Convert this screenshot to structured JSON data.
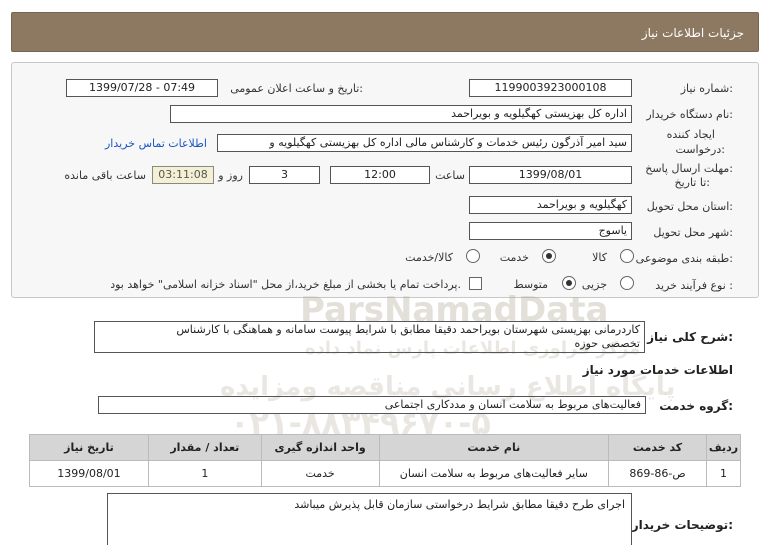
{
  "header": {
    "title": "جزئیات اطلاعات نیاز"
  },
  "fields": {
    "need_number_label": "شماره نیاز:",
    "need_number": "1199003923000108",
    "announce_label": "تاریخ و ساعت اعلان عمومی:",
    "announce_value": "1399/07/28 - 07:49",
    "buyer_label": "نام دستگاه خریدار:",
    "buyer_value": "اداره کل بهزیستی کهگیلویه و بویراحمد",
    "creator_label_1": "ایجاد کننده",
    "creator_label_2": "درخواست:",
    "creator_value": "سید امیر آذرگون رئیس خدمات و کارشناس مالی اداره کل بهزیستی کهگیلویه و",
    "contact_link": "اطلاعات تماس خریدار",
    "deadline_label_1": "مهلت ارسال پاسخ:",
    "deadline_label_2": "تا تاریخ:",
    "deadline_date": "1399/08/01",
    "time_label": "ساعت",
    "deadline_time": "12:00",
    "days_value": "3",
    "days_label": "روز و",
    "remaining_time": "03:11:08",
    "remaining_label": "ساعت باقی مانده",
    "province_label": "استان محل تحویل:",
    "province_value": "کهگیلویه و بویراحمد",
    "city_label": "شهر محل تحویل:",
    "city_value": "یاسوج",
    "category_label": "طبقه بندی موضوعی:",
    "category_options": [
      "کالا",
      "خدمت",
      "کالا/خدمت"
    ],
    "process_label": "نوع فرآیند خرید :",
    "process_options": [
      "جزیی",
      "متوسط"
    ],
    "payment_note": "پرداخت تمام یا بخشی از مبلغ خرید،از محل \"اسناد خزانه اسلامی\" خواهد بود."
  },
  "summary": {
    "label": "شرح کلی نیاز:",
    "text_line1": "کاردرمانی بهزیستی شهرستان بویراحمد دقیقا مطابق با شرایط پیوست سامانه و هماهنگی با کارشناس",
    "text_line2": "تخصصی حوزه"
  },
  "services_title": "اطلاعات خدمات مورد نیاز",
  "service_group": {
    "label": "گروه خدمت:",
    "value": "فعالیت‌های مربوط به سلامت انسان و مددکاری اجتماعی"
  },
  "table": {
    "headers": [
      "ردیف",
      "کد خدمت",
      "نام خدمت",
      "واحد اندازه گیری",
      "تعداد / مقدار",
      "تاریخ نیاز"
    ],
    "rows": [
      [
        "1",
        "ص-86-869",
        "سایر فعالیت‌های مربوط به سلامت انسان",
        "خدمت",
        "1",
        "1399/08/01"
      ]
    ]
  },
  "buyer_notes": {
    "label": "توضیحات خریدار:",
    "text": "اجرای طرح دقیقا مطابق شرایط درخواستی سازمان قابل پذیرش میباشد"
  },
  "watermark": {
    "brand": "ParsNamadData",
    "line1": "مرکز فراوری اطلاعات پارس نماد داده",
    "line2": "پایگاه اطلاع رسانی مناقصه ومزایده",
    "phone": "۰۲۱-۸۸۳۴۹۶۷۰-۵"
  },
  "colors": {
    "header_bg": "#8d7961",
    "link": "#1a55c4",
    "remaining_bg": "#f4f0d4"
  }
}
